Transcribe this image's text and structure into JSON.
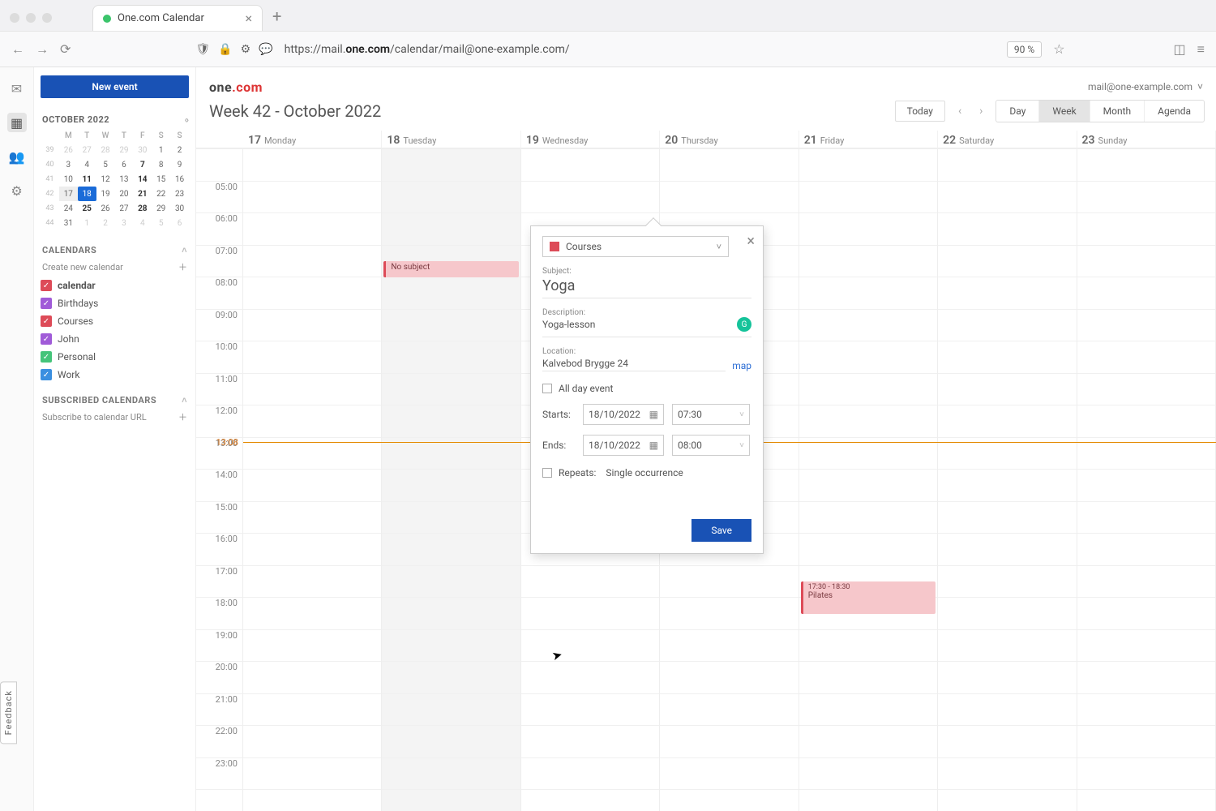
{
  "browser": {
    "tab_title": "One.com Calendar",
    "url_prefix": "https://mail.",
    "url_bold": "one.com",
    "url_suffix": "/calendar/mail@one-example.com/",
    "zoom": "90 %"
  },
  "header": {
    "logo_a": "one",
    "logo_b": ".com",
    "account": "mail@one-example.com"
  },
  "toolbar": {
    "title": "Week 42 - October 2022",
    "today": "Today",
    "views": [
      "Day",
      "Week",
      "Month",
      "Agenda"
    ],
    "active_view": "Week"
  },
  "sidebar": {
    "new_event": "New event",
    "mini_month": "OCTOBER 2022",
    "dow": [
      "M",
      "T",
      "W",
      "T",
      "F",
      "S",
      "S"
    ],
    "weeks": [
      {
        "wk": "39",
        "d": [
          "26",
          "27",
          "28",
          "29",
          "30",
          "1",
          "2"
        ],
        "dim": [
          0,
          1,
          2,
          3,
          4
        ]
      },
      {
        "wk": "40",
        "d": [
          "3",
          "4",
          "5",
          "6",
          "7",
          "8",
          "9"
        ],
        "bold": [
          4
        ]
      },
      {
        "wk": "41",
        "d": [
          "10",
          "11",
          "12",
          "13",
          "14",
          "15",
          "16"
        ],
        "bold": [
          1,
          4
        ]
      },
      {
        "wk": "42",
        "d": [
          "17",
          "18",
          "19",
          "20",
          "21",
          "22",
          "23"
        ],
        "sel": [
          0
        ],
        "today": [
          1
        ],
        "bold": [
          4
        ]
      },
      {
        "wk": "43",
        "d": [
          "24",
          "25",
          "26",
          "27",
          "28",
          "29",
          "30"
        ],
        "bold": [
          1,
          4
        ]
      },
      {
        "wk": "44",
        "d": [
          "31",
          "1",
          "2",
          "3",
          "4",
          "5",
          "6"
        ],
        "dim": [
          1,
          2,
          3,
          4,
          5,
          6
        ]
      }
    ],
    "section_cal": "CALENDARS",
    "create_cal": "Create new calendar",
    "calendars": [
      {
        "name": "calendar",
        "color": "#dd4b58",
        "bold": true
      },
      {
        "name": "Birthdays",
        "color": "#a05bd8"
      },
      {
        "name": "Courses",
        "color": "#dd4b58"
      },
      {
        "name": "John",
        "color": "#a05bd8"
      },
      {
        "name": "Personal",
        "color": "#45c47a"
      },
      {
        "name": "Work",
        "color": "#3a8fe0"
      }
    ],
    "section_sub": "SUBSCRIBED CALENDARS",
    "subscribe": "Subscribe to calendar URL"
  },
  "weekview": {
    "days": [
      {
        "num": "17",
        "name": "Monday"
      },
      {
        "num": "18",
        "name": "Tuesday"
      },
      {
        "num": "19",
        "name": "Wednesday"
      },
      {
        "num": "20",
        "name": "Thursday"
      },
      {
        "num": "21",
        "name": "Friday"
      },
      {
        "num": "22",
        "name": "Saturday"
      },
      {
        "num": "23",
        "name": "Sunday"
      }
    ],
    "hours": [
      "",
      "05:00",
      "06:00",
      "07:00",
      "08:00",
      "09:00",
      "10:00",
      "11:00",
      "12:00",
      "13:00",
      "14:00",
      "15:00",
      "16:00",
      "17:00",
      "18:00",
      "19:00",
      "20:00",
      "21:00",
      "22:00",
      "23:00"
    ],
    "now": "13:08",
    "events": {
      "tue_label": "No subject",
      "fri_time": "17:30  -  18:30",
      "fri_label": "Pilates"
    }
  },
  "popover": {
    "calendar": "Courses",
    "subject_label": "Subject:",
    "subject": "Yoga",
    "desc_label": "Description:",
    "desc": "Yoga-lesson",
    "loc_label": "Location:",
    "location": "Kalvebod Brygge 24",
    "map": "map",
    "allday": "All day event",
    "starts_label": "Starts:",
    "ends_label": "Ends:",
    "date": "18/10/2022",
    "start_time": "07:30",
    "end_time": "08:00",
    "repeats_label": "Repeats:",
    "repeats_value": "Single occurrence",
    "save": "Save"
  },
  "feedback": "Feedback"
}
